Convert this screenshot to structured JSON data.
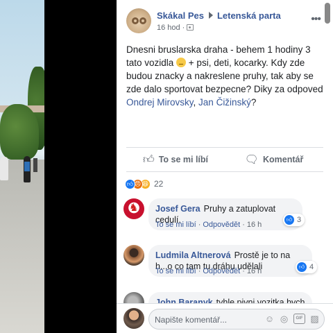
{
  "post": {
    "author": "Skákal Pes",
    "group": "Letenská parta",
    "time": "16 hod",
    "text_before": "Dnesni bruslarska draha - behem 1 hodiny 3 tato vozidla ",
    "text_after": " + psi, deti, kocarky. Kdy zde budou znacky a nakreslene pruhy, tak aby se zde dalo sportovat bezpecne? Diky za odpoved ",
    "mention1": "Ondrej Mirovsky",
    "mention_sep": ", ",
    "mention2": "Jan Čižinský",
    "text_end": "?"
  },
  "actions": {
    "like": "To se mi líbí",
    "comment": "Komentář"
  },
  "reactions": {
    "count": "22",
    "types": [
      "like",
      "angry",
      "haha"
    ]
  },
  "comments": [
    {
      "author": "Josef Gera",
      "text": "Pruhy a zatuplovat cedulí.",
      "like": "To se mi líbí",
      "reply": "Odpovědět",
      "time": "16 h",
      "likes": "3"
    },
    {
      "author": "Ludmila Altnerová",
      "text": "Prostě je to na h...o co tam tu dráhu udělali",
      "like": "To se mi líbí",
      "reply": "Odpovědět",
      "time": "16 h",
      "likes": "4"
    },
    {
      "author": "John Baranyk",
      "text": "tyhle pivni vozitka bych na letny okamzite zakazal, nema to tam"
    }
  ],
  "composer": {
    "placeholder": "Napište komentář...",
    "gif": "GIF"
  },
  "colors": {
    "link": "#385898",
    "like": "#1877f2",
    "bubble": "#f2f3f5"
  }
}
